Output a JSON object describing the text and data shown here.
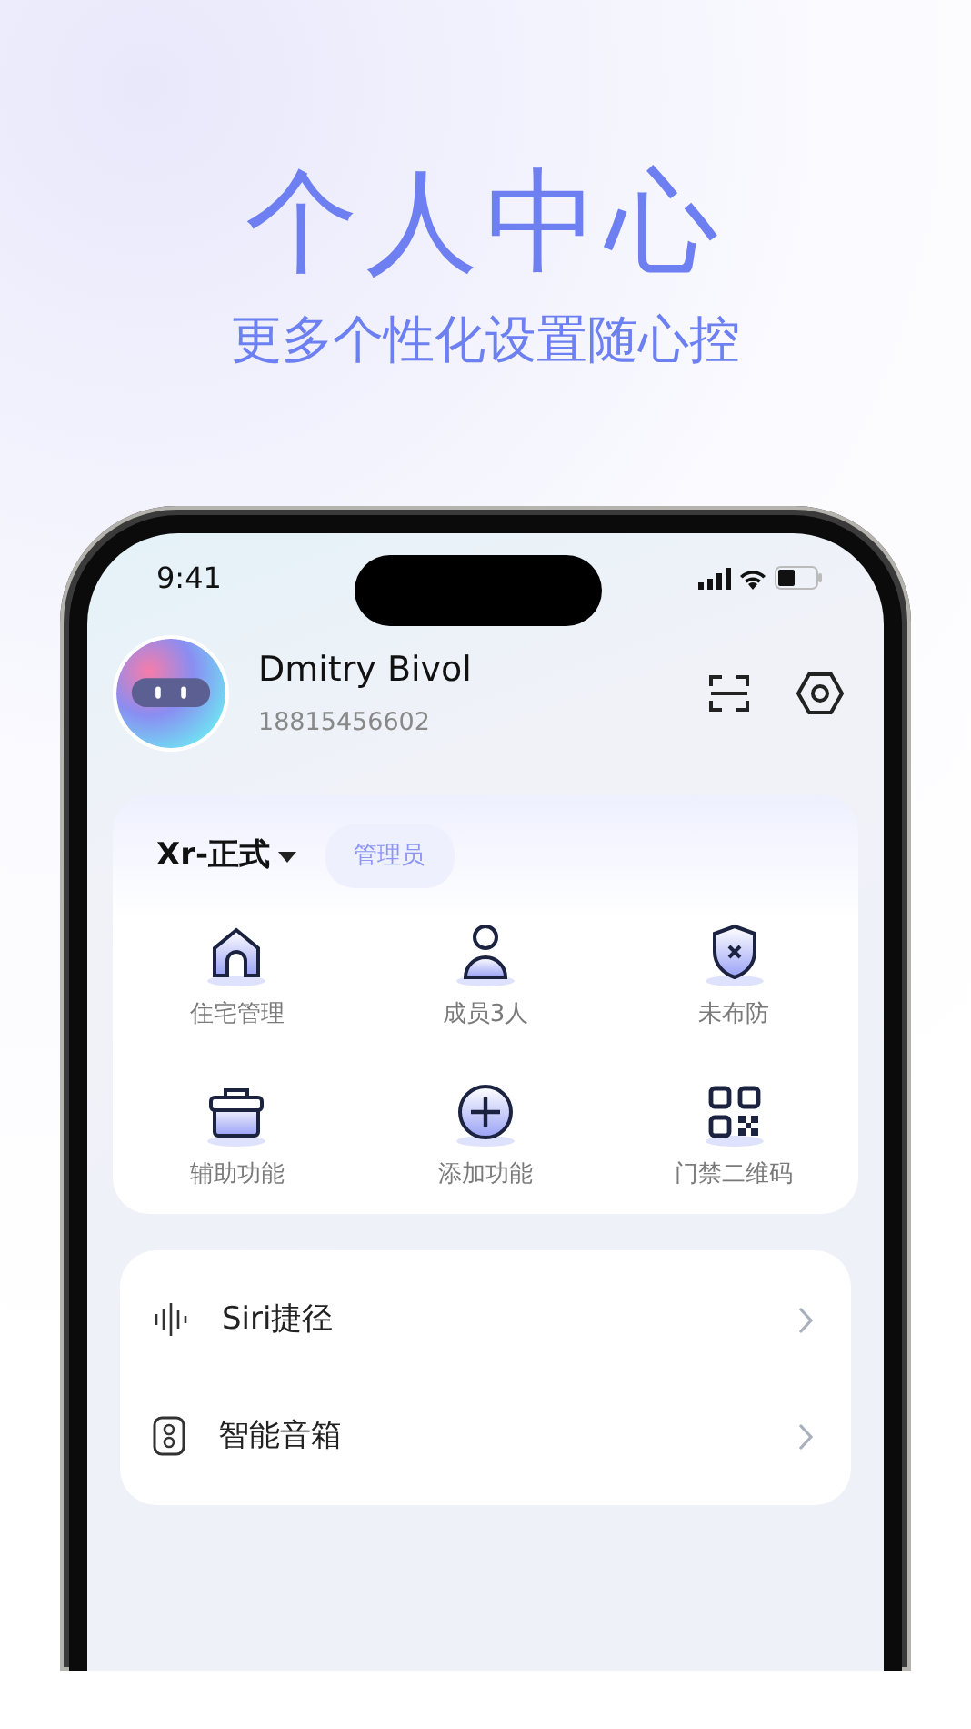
{
  "headline": "个人中心",
  "subtitle": "更多个性化设置随心控",
  "status_bar": {
    "time": "9:41"
  },
  "profile": {
    "name": "Dmitry Bivol",
    "phone": "18815456602"
  },
  "home": {
    "name": "Xr-正式",
    "role": "管理员"
  },
  "shortcuts": [
    {
      "label": "住宅管理"
    },
    {
      "label": "成员3人"
    },
    {
      "label": "未布防"
    },
    {
      "label": "辅助功能"
    },
    {
      "label": "添加功能"
    },
    {
      "label": "门禁二维码"
    }
  ],
  "menu": [
    {
      "label": "Siri捷径"
    },
    {
      "label": "智能音箱"
    }
  ]
}
